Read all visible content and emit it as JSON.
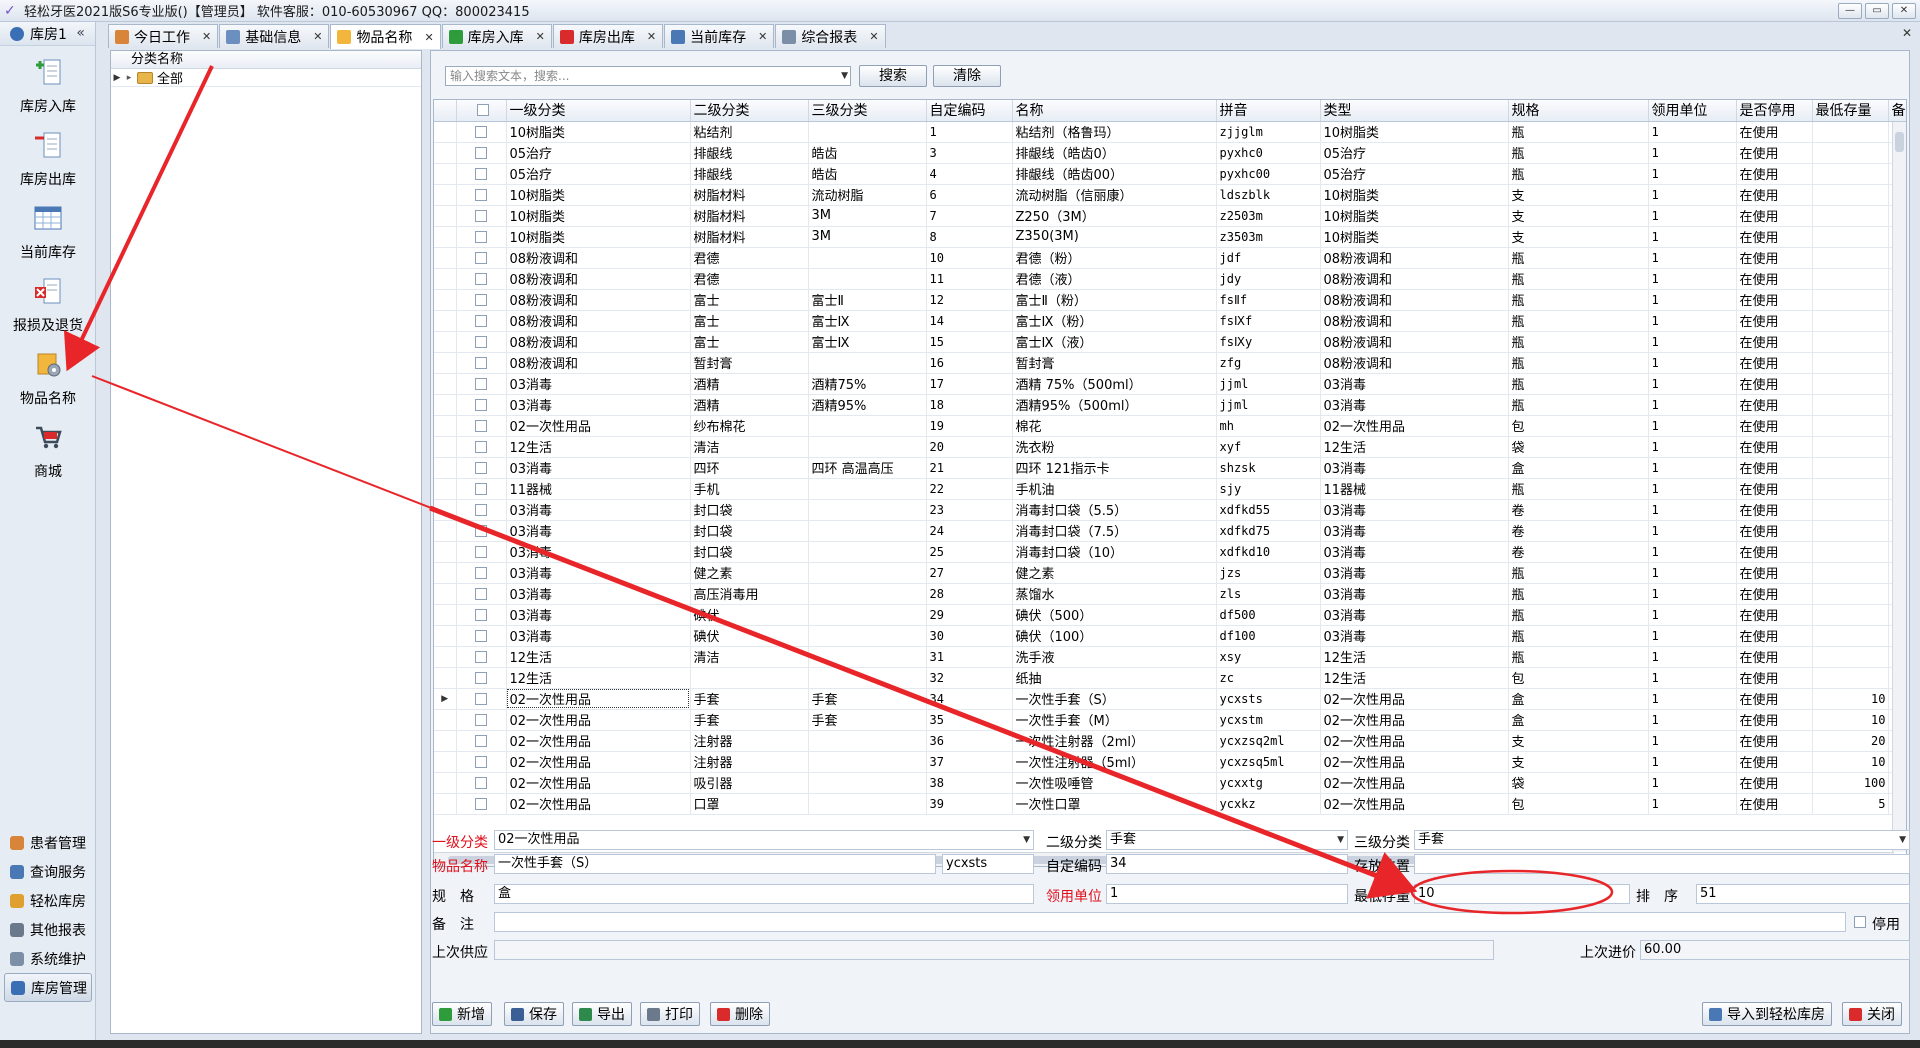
{
  "window": {
    "title": "轻松牙医2021版S6专业版()【管理员】    软件客服：010-60530967  QQ：800023415",
    "min_glyph": "—",
    "max_glyph": "▭",
    "close_glyph": "✕"
  },
  "sidebar": {
    "header": "库房1",
    "collapse_glyph": "«",
    "items": [
      {
        "label": "库房入库"
      },
      {
        "label": "库房出库"
      },
      {
        "label": "当前库存"
      },
      {
        "label": "报损及退货"
      },
      {
        "label": "物品名称"
      },
      {
        "label": "商城"
      }
    ],
    "bottom_items": [
      {
        "label": "患者管理"
      },
      {
        "label": "查询服务"
      },
      {
        "label": "轻松库房"
      },
      {
        "label": "其他报表"
      },
      {
        "label": "系统维护"
      },
      {
        "label": "库房管理"
      }
    ]
  },
  "tabs": [
    {
      "label": "今日工作"
    },
    {
      "label": "基础信息"
    },
    {
      "label": "物品名称"
    },
    {
      "label": "库房入库"
    },
    {
      "label": "库房出库"
    },
    {
      "label": "当前库存"
    },
    {
      "label": "综合报表"
    }
  ],
  "tree": {
    "header": "分类名称",
    "root": "全部"
  },
  "search": {
    "placeholder": "输入搜索文本，搜索...",
    "search_label": "搜索",
    "clear_label": "清除"
  },
  "grid": {
    "columns": [
      "",
      "一级分类",
      "二级分类",
      "三级分类",
      "自定编码",
      "名称",
      "拼音",
      "类型",
      "规格",
      "领用单位",
      "是否停用",
      "最低存量",
      "备"
    ],
    "rows": [
      [
        "10树脂类",
        "粘结剂",
        "",
        "1",
        "粘结剂（格鲁玛）",
        "zjjglm",
        "10树脂类",
        "瓶",
        "1",
        "在使用",
        ""
      ],
      [
        "05治疗",
        "排龈线",
        "皓齿",
        "3",
        "排龈线（皓齿0）",
        "pyxhc0",
        "05治疗",
        "瓶",
        "1",
        "在使用",
        ""
      ],
      [
        "05治疗",
        "排龈线",
        "皓齿",
        "4",
        "排龈线（皓齿00）",
        "pyxhc00",
        "05治疗",
        "瓶",
        "1",
        "在使用",
        ""
      ],
      [
        "10树脂类",
        "树脂材料",
        "流动树脂",
        "6",
        "流动树脂（信丽康）",
        "ldszblk",
        "10树脂类",
        "支",
        "1",
        "在使用",
        ""
      ],
      [
        "10树脂类",
        "树脂材料",
        "3M",
        "7",
        "Z250（3M）",
        "z2503m",
        "10树脂类",
        "支",
        "1",
        "在使用",
        ""
      ],
      [
        "10树脂类",
        "树脂材料",
        "3M",
        "8",
        "Z350(3M)",
        "z3503m",
        "10树脂类",
        "支",
        "1",
        "在使用",
        ""
      ],
      [
        "08粉液调和",
        "君德",
        "",
        "10",
        "君德（粉）",
        "jdf",
        "08粉液调和",
        "瓶",
        "1",
        "在使用",
        ""
      ],
      [
        "08粉液调和",
        "君德",
        "",
        "11",
        "君德（液）",
        "jdy",
        "08粉液调和",
        "瓶",
        "1",
        "在使用",
        ""
      ],
      [
        "08粉液调和",
        "富士",
        "富士Ⅱ",
        "12",
        "富士Ⅱ（粉）",
        "fsⅡf",
        "08粉液调和",
        "瓶",
        "1",
        "在使用",
        ""
      ],
      [
        "08粉液调和",
        "富士",
        "富士Ⅸ",
        "14",
        "富士Ⅸ（粉）",
        "fsⅨf",
        "08粉液调和",
        "瓶",
        "1",
        "在使用",
        ""
      ],
      [
        "08粉液调和",
        "富士",
        "富士Ⅸ",
        "15",
        "富士Ⅸ（液）",
        "fsⅨy",
        "08粉液调和",
        "瓶",
        "1",
        "在使用",
        ""
      ],
      [
        "08粉液调和",
        "暂封膏",
        "",
        "16",
        "暂封膏",
        "zfg",
        "08粉液调和",
        "瓶",
        "1",
        "在使用",
        ""
      ],
      [
        "03消毒",
        "酒精",
        "酒精75%",
        "17",
        "酒精 75%（500ml）",
        "jjml",
        "03消毒",
        "瓶",
        "1",
        "在使用",
        ""
      ],
      [
        "03消毒",
        "酒精",
        "酒精95%",
        "18",
        "酒精95%（500ml）",
        "jjml",
        "03消毒",
        "瓶",
        "1",
        "在使用",
        ""
      ],
      [
        "02一次性用品",
        "纱布棉花",
        "",
        "19",
        "棉花",
        "mh",
        "02一次性用品",
        "包",
        "1",
        "在使用",
        ""
      ],
      [
        "12生活",
        "清洁",
        "",
        "20",
        "洗衣粉",
        "xyf",
        "12生活",
        "袋",
        "1",
        "在使用",
        ""
      ],
      [
        "03消毒",
        "四环",
        "四环 高温高压",
        "21",
        "四环 121指示卡",
        "shzsk",
        "03消毒",
        "盒",
        "1",
        "在使用",
        ""
      ],
      [
        "11器械",
        "手机",
        "",
        "22",
        "手机油",
        "sjy",
        "11器械",
        "瓶",
        "1",
        "在使用",
        ""
      ],
      [
        "03消毒",
        "封口袋",
        "",
        "23",
        "消毒封口袋（5.5）",
        "xdfkd55",
        "03消毒",
        "卷",
        "1",
        "在使用",
        ""
      ],
      [
        "03消毒",
        "封口袋",
        "",
        "24",
        "消毒封口袋（7.5）",
        "xdfkd75",
        "03消毒",
        "卷",
        "1",
        "在使用",
        ""
      ],
      [
        "03消毒",
        "封口袋",
        "",
        "25",
        "消毒封口袋（10）",
        "xdfkd10",
        "03消毒",
        "卷",
        "1",
        "在使用",
        ""
      ],
      [
        "03消毒",
        "健之素",
        "",
        "27",
        "健之素",
        "jzs",
        "03消毒",
        "瓶",
        "1",
        "在使用",
        ""
      ],
      [
        "03消毒",
        "高压消毒用",
        "",
        "28",
        "蒸馏水",
        "zls",
        "03消毒",
        "瓶",
        "1",
        "在使用",
        ""
      ],
      [
        "03消毒",
        "碘伏",
        "",
        "29",
        "碘伏（500）",
        "df500",
        "03消毒",
        "瓶",
        "1",
        "在使用",
        ""
      ],
      [
        "03消毒",
        "碘伏",
        "",
        "30",
        "碘伏（100）",
        "df100",
        "03消毒",
        "瓶",
        "1",
        "在使用",
        ""
      ],
      [
        "12生活",
        "清洁",
        "",
        "31",
        "洗手液",
        "xsy",
        "12生活",
        "瓶",
        "1",
        "在使用",
        ""
      ],
      [
        "12生活",
        "",
        "",
        "32",
        "纸抽",
        "zc",
        "12生活",
        "包",
        "1",
        "在使用",
        ""
      ],
      [
        "02一次性用品",
        "手套",
        "手套",
        "34",
        "一次性手套（S）",
        "ycxsts",
        "02一次性用品",
        "盒",
        "1",
        "在使用",
        "10"
      ],
      [
        "02一次性用品",
        "手套",
        "手套",
        "35",
        "一次性手套（M）",
        "ycxstm",
        "02一次性用品",
        "盒",
        "1",
        "在使用",
        "10"
      ],
      [
        "02一次性用品",
        "注射器",
        "",
        "36",
        "一次性注射器（2ml）",
        "ycxzsq2ml",
        "02一次性用品",
        "支",
        "1",
        "在使用",
        "20"
      ],
      [
        "02一次性用品",
        "注射器",
        "",
        "37",
        "一次性注射器（5ml）",
        "ycxzsq5ml",
        "02一次性用品",
        "支",
        "1",
        "在使用",
        "10"
      ],
      [
        "02一次性用品",
        "吸引器",
        "",
        "38",
        "一次性吸唾管",
        "ycxxtg",
        "02一次性用品",
        "袋",
        "1",
        "在使用",
        "100"
      ],
      [
        "02一次性用品",
        "口罩",
        "",
        "39",
        "一次性口罩",
        "ycxkz",
        "02一次性用品",
        "包",
        "1",
        "在使用",
        "5"
      ]
    ],
    "current_row_index": 27
  },
  "form": {
    "level1_label": "一级分类",
    "level1_value": "02一次性用品",
    "level2_label": "二级分类",
    "level2_value": "手套",
    "level3_label": "三级分类",
    "level3_value": "手套",
    "name_label": "物品名称",
    "name_value": "一次性手套（S）",
    "pinyin_value": "ycxsts",
    "code_label": "自定编码",
    "code_value": "34",
    "location_label": "存放位置",
    "location_value": "",
    "spec_label": "规　格",
    "spec_value": "盒",
    "unit_label": "领用单位",
    "unit_value": "1",
    "min_stock_label": "最低存量",
    "min_stock_value": "10",
    "order_label": "排　序",
    "order_value": "51",
    "remark_label": "备　注",
    "remark_value": "",
    "disabled_label": "停用",
    "last_supplier_label": "上次供应",
    "last_supplier_value": "",
    "last_price_label": "上次进价",
    "last_price_value": "60.00"
  },
  "footer": {
    "add_label": "新增",
    "save_label": "保存",
    "export_label": "导出",
    "print_label": "打印",
    "delete_label": "删除",
    "import_label": "导入到轻松库房",
    "close_label": "关闭"
  },
  "annotation_color": "#e8262a",
  "colors": {
    "required_label": "#e0101b"
  }
}
